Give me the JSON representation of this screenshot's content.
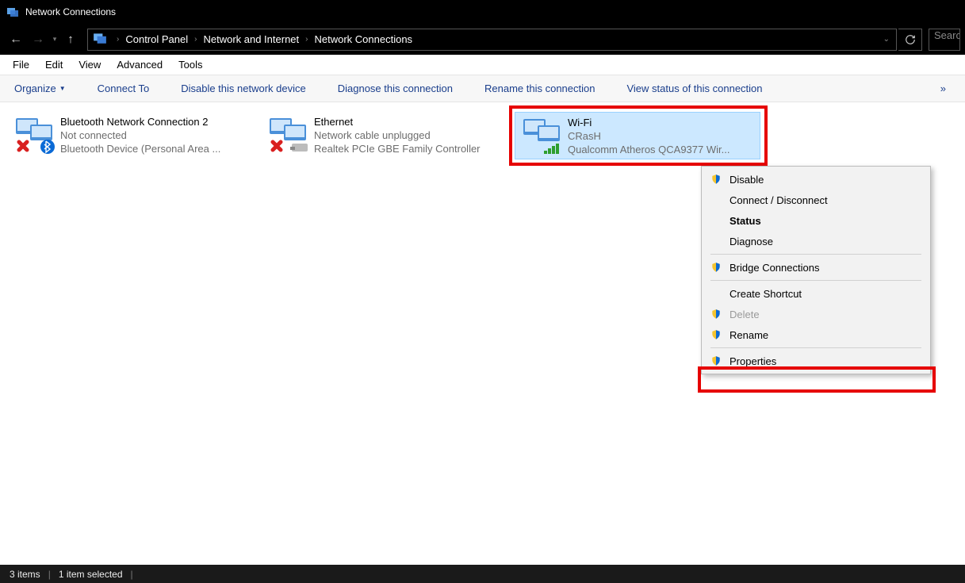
{
  "window": {
    "title": "Network Connections"
  },
  "breadcrumb": [
    "Control Panel",
    "Network and Internet",
    "Network Connections"
  ],
  "search_placeholder": "Search",
  "menubar": [
    "File",
    "Edit",
    "View",
    "Advanced",
    "Tools"
  ],
  "toolbar": {
    "organize": "Organize",
    "connect_to": "Connect To",
    "disable": "Disable this network device",
    "diagnose": "Diagnose this connection",
    "rename": "Rename this connection",
    "view_status": "View status of this connection"
  },
  "connections": [
    {
      "name": "Bluetooth Network Connection 2",
      "status": "Not connected",
      "device": "Bluetooth Device (Personal Area ..."
    },
    {
      "name": "Ethernet",
      "status": "Network cable unplugged",
      "device": "Realtek PCIe GBE Family Controller"
    },
    {
      "name": "Wi-Fi",
      "status": "CRasH",
      "device": "Qualcomm Atheros QCA9377 Wir..."
    }
  ],
  "context_menu": {
    "disable": "Disable",
    "connect": "Connect / Disconnect",
    "status": "Status",
    "diagnose": "Diagnose",
    "bridge": "Bridge Connections",
    "shortcut": "Create Shortcut",
    "delete": "Delete",
    "rename": "Rename",
    "properties": "Properties"
  },
  "statusbar": {
    "count": "3 items",
    "selected": "1 item selected"
  }
}
